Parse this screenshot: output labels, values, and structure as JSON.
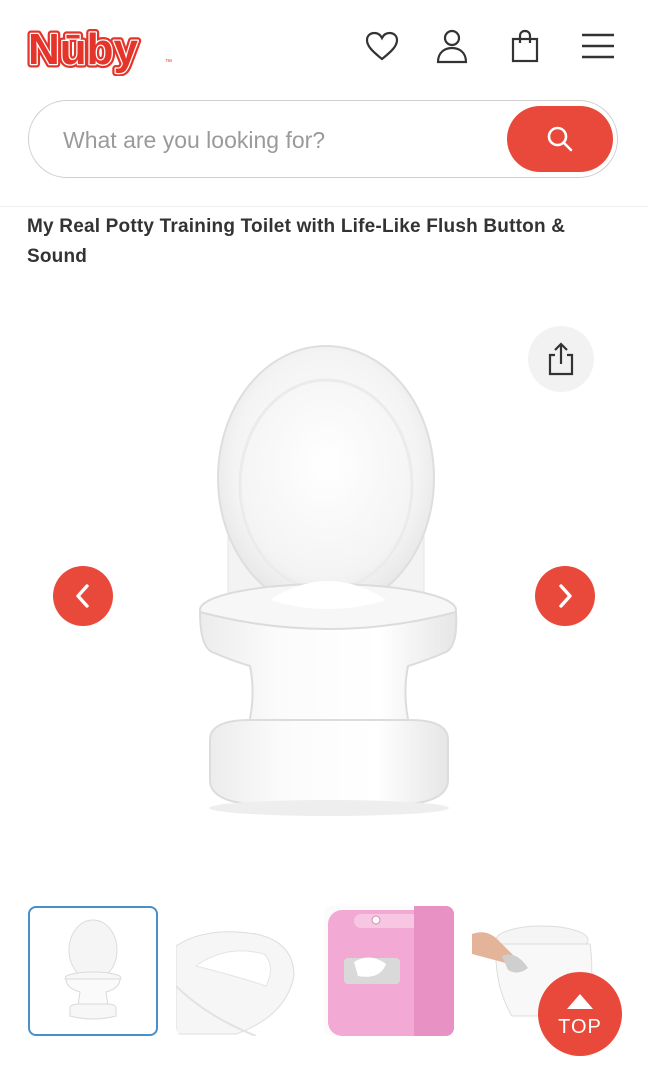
{
  "brand": {
    "logo_text": "Nūby",
    "trademark": "™",
    "accent_color": "#e9493b"
  },
  "header": {
    "icons": [
      "heart-icon",
      "account-icon",
      "bag-icon",
      "menu-icon"
    ]
  },
  "search": {
    "placeholder": "What are you looking for?",
    "value": ""
  },
  "product": {
    "title": "My Real Potty Training Toilet with Life-Like Flush Button & Sound"
  },
  "gallery": {
    "thumbnails": [
      "main-potty",
      "seat-closeup",
      "pink-wipes-holder",
      "flush-demo"
    ],
    "selected_index": 0
  },
  "top_button": {
    "label": "TOP"
  }
}
